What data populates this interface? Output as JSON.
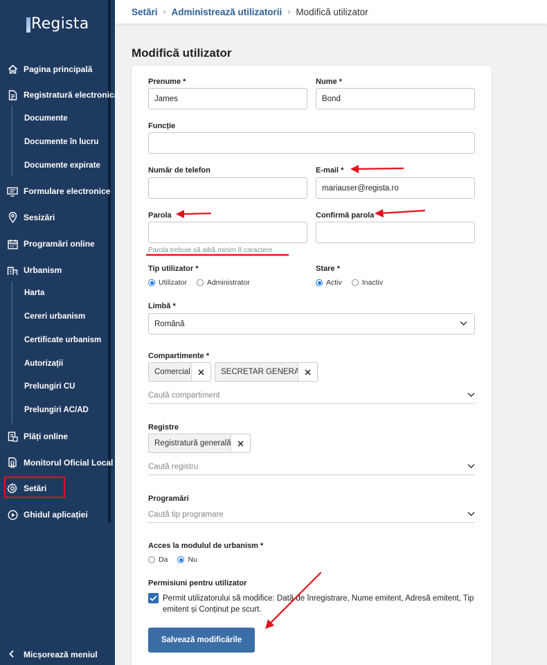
{
  "app": {
    "name": "Regista"
  },
  "sidebar": {
    "items": [
      {
        "label": "Pagina principală",
        "icon": "home-icon"
      },
      {
        "label": "Registratură electronică",
        "icon": "document-icon"
      },
      {
        "label": "Documente"
      },
      {
        "label": "Documente în lucru"
      },
      {
        "label": "Documente expirate"
      },
      {
        "label": "Formulare electronice",
        "icon": "form-icon"
      },
      {
        "label": "Sesizări",
        "icon": "location-pin-icon"
      },
      {
        "label": "Programări online",
        "icon": "calendar-icon"
      },
      {
        "label": "Urbanism",
        "icon": "building-icon"
      },
      {
        "label": "Harta"
      },
      {
        "label": "Cereri urbanism"
      },
      {
        "label": "Certificate urbanism"
      },
      {
        "label": "Autorizații"
      },
      {
        "label": "Prelungiri CU"
      },
      {
        "label": "Prelungiri AC/AD"
      },
      {
        "label": "Plăți online",
        "icon": "payment-icon"
      },
      {
        "label": "Monitorul Oficial Local",
        "icon": "certificate-icon"
      },
      {
        "label": "Setări",
        "icon": "gear-icon"
      },
      {
        "label": "Ghidul aplicației",
        "icon": "play-circle-icon"
      }
    ],
    "collapse_label": "Micșorează meniul"
  },
  "breadcrumb": {
    "items": [
      "Setări",
      "Administrează utilizatorii"
    ],
    "current": "Modifică utilizator"
  },
  "page": {
    "title": "Modifică utilizator"
  },
  "form": {
    "first_name": {
      "label": "Prenume *",
      "value": "James"
    },
    "last_name": {
      "label": "Nume *",
      "value": "Bond"
    },
    "function": {
      "label": "Funcție",
      "value": ""
    },
    "phone": {
      "label": "Număr de telefon",
      "value": ""
    },
    "email": {
      "label": "E-mail *",
      "value": "mariauser@regista.ro"
    },
    "password": {
      "label": "Parola",
      "value": "",
      "hint": "Parola trebuie să aibă minim 8 caractere"
    },
    "confirm_password": {
      "label": "Confirmă parola",
      "value": ""
    },
    "user_type": {
      "label": "Tip utilizator *",
      "options": [
        "Utilizator",
        "Administrator"
      ],
      "selected": "Utilizator"
    },
    "status": {
      "label": "Stare *",
      "options": [
        "Activ",
        "Inactiv"
      ],
      "selected": "Activ"
    },
    "language": {
      "label": "Limbă *",
      "value": "Română"
    },
    "departments": {
      "label": "Compartimente *",
      "chips": [
        "Comercial",
        "SECRETAR GENERAL"
      ],
      "placeholder": "Caută compartiment"
    },
    "registers": {
      "label": "Registre",
      "chips": [
        "Registratură generală"
      ],
      "placeholder": "Caută registru"
    },
    "appointments": {
      "label": "Programări",
      "placeholder": "Caută tip programare"
    },
    "urbanism_access": {
      "label": "Acces la modulul de urbanism *",
      "options": [
        "Da",
        "Nu"
      ],
      "selected": "Nu"
    },
    "permissions": {
      "label": "Permisiuni pentru utilizator",
      "checked": true,
      "text": "Permit utilizatorului să modifice: Dată de înregistrare, Nume emitent, Adresă emitent, Tip emitent și Conținut pe scurt."
    },
    "save_label": "Salvează modificările"
  },
  "colors": {
    "sidebar": "#1f3a5f",
    "accent": "#3c6ea6",
    "radio": "#1a73e8",
    "annotation": "#e2121b"
  }
}
